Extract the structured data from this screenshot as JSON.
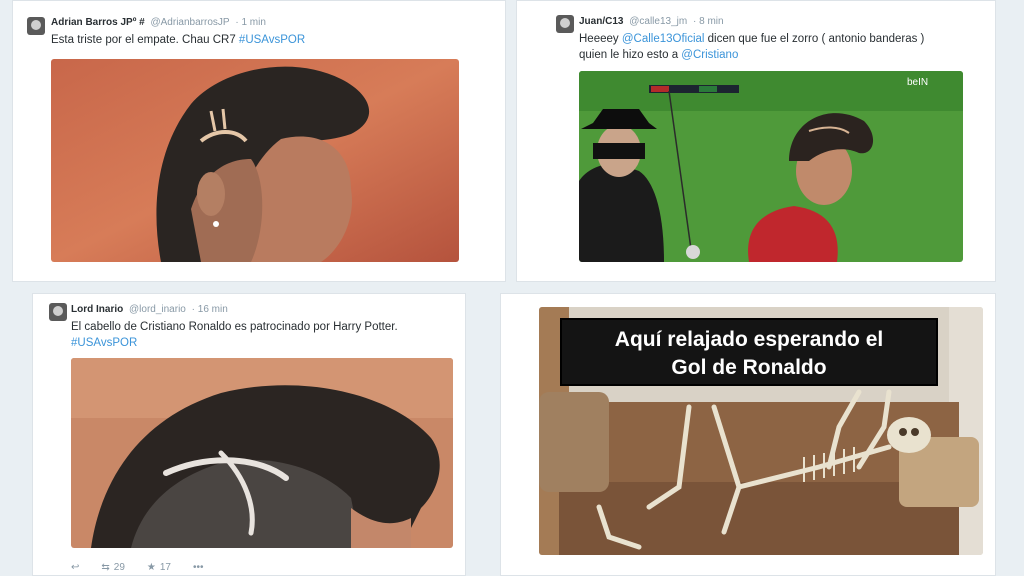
{
  "tweets": [
    {
      "name": "Adrian Barros JP",
      "mark": "º #",
      "handle": "@AdrianbarrosJP",
      "time": "· 1 min",
      "text": "Esta triste por el empate. Chau CR7 ",
      "hashtag": "#USAvsPOR"
    },
    {
      "name": "Juan/C13",
      "handle": "@calle13_jm",
      "time": "· 8 min",
      "text_prefix": "Heeeey ",
      "mention": "@Calle13Oficial",
      "text_middle": " dicen que fue el zorro ( antonio banderas )",
      "text_line2": "quien le hizo esto a ",
      "mention2": "@Cristiano",
      "broadcast_logo": "beIN"
    },
    {
      "name": "Lord Inario",
      "handle": "@lord_inario",
      "time": "· 16 min",
      "text": "El cabello de Cristiano Ronaldo es patrocinado por Harry Potter.",
      "hashtag": "#USAvsPOR",
      "retweets": "29",
      "favorites": "17"
    }
  ],
  "meme": {
    "caption_line1": "Aquí relajado esperando el",
    "caption_line2": "Gol de Ronaldo"
  },
  "icons": [
    "reply-icon",
    "retweet-icon",
    "favorite-icon",
    "more-icon"
  ],
  "colors": {
    "link": "#3b94d9",
    "text": "#292f33",
    "muted": "#8899a6"
  }
}
